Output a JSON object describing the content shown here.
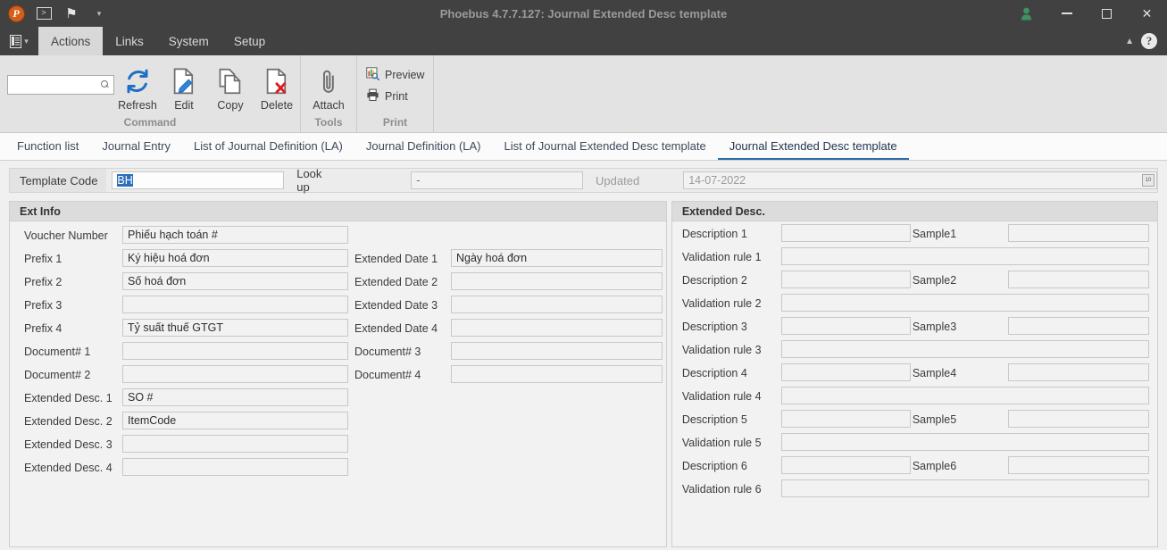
{
  "window": {
    "title": "Phoebus 4.7.7.127: Journal Extended Desc template",
    "logo_letter": "P",
    "quick_access": {
      "run_icon": ">",
      "bookmark_icon": "⚑",
      "dropdown_icon": "▾"
    },
    "controls": {
      "user_icon": "♟",
      "minimize": "—",
      "maximize": "□",
      "close": "✕"
    }
  },
  "menubar": {
    "app_icon": "document-menu",
    "items": [
      {
        "label": "Actions",
        "active": true
      },
      {
        "label": "Links",
        "active": false
      },
      {
        "label": "System",
        "active": false
      },
      {
        "label": "Setup",
        "active": false
      }
    ],
    "collapse_icon": "▲",
    "help_icon": "?"
  },
  "ribbon": {
    "search": {
      "value": "",
      "placeholder": ""
    },
    "groups": [
      {
        "title": "Command",
        "buttons": [
          {
            "label": "Refresh",
            "icon": "refresh-icon"
          },
          {
            "label": "Edit",
            "icon": "edit-icon"
          },
          {
            "label": "Copy",
            "icon": "copy-icon"
          },
          {
            "label": "Delete",
            "icon": "delete-icon"
          }
        ]
      },
      {
        "title": "Tools",
        "buttons": [
          {
            "label": "Attach",
            "icon": "attach-icon"
          }
        ]
      },
      {
        "title": "Print",
        "buttons": [
          {
            "label": "Preview",
            "icon": "preview-icon"
          },
          {
            "label": "Print",
            "icon": "print-icon"
          }
        ]
      }
    ]
  },
  "tabs": [
    {
      "label": "Function list",
      "selected": false
    },
    {
      "label": "Journal Entry",
      "selected": false
    },
    {
      "label": "List of Journal Definition (LA)",
      "selected": false
    },
    {
      "label": "Journal Definition (LA)",
      "selected": false
    },
    {
      "label": "List of Journal Extended Desc template",
      "selected": false
    },
    {
      "label": "Journal Extended Desc template",
      "selected": true
    }
  ],
  "header": {
    "template_code_label": "Template Code",
    "template_code_value": "BH",
    "lookup_label": "Look up",
    "lookup_value": "-",
    "updated_label": "Updated",
    "updated_value": "14-07-2022",
    "calendar_icon": "calendar-icon"
  },
  "ext_info": {
    "title": "Ext Info",
    "left_rows": [
      {
        "label": "Voucher Number",
        "value": "Phiếu hạch toán #"
      },
      {
        "label": "Prefix 1",
        "value": "Ký hiệu hoá đơn"
      },
      {
        "label": "Prefix 2",
        "value": "Số hoá đơn"
      },
      {
        "label": "Prefix 3",
        "value": ""
      },
      {
        "label": "Prefix 4",
        "value": "Tỷ suất thuế GTGT"
      },
      {
        "label": "Document# 1",
        "value": ""
      },
      {
        "label": "Document# 2",
        "value": ""
      },
      {
        "label": "Extended Desc. 1",
        "value": "SO #"
      },
      {
        "label": "Extended Desc. 2",
        "value": "ItemCode"
      },
      {
        "label": "Extended Desc. 3",
        "value": ""
      },
      {
        "label": "Extended Desc. 4",
        "value": ""
      }
    ],
    "right_rows": [
      {
        "label": "Extended Date 1",
        "value": "Ngày hoá đơn"
      },
      {
        "label": "Extended Date 2",
        "value": ""
      },
      {
        "label": "Extended Date 3",
        "value": ""
      },
      {
        "label": "Extended Date 4",
        "value": ""
      },
      {
        "label": "Document# 3",
        "value": ""
      },
      {
        "label": "Document# 4",
        "value": ""
      }
    ]
  },
  "extended_desc": {
    "title": "Extended Desc.",
    "rows": [
      {
        "type": "desc",
        "label": "Description 1",
        "value": "",
        "sample_label": "Sample1",
        "sample_value": ""
      },
      {
        "type": "rule",
        "label": "Validation rule 1",
        "value": ""
      },
      {
        "type": "desc",
        "label": "Description 2",
        "value": "",
        "sample_label": "Sample2",
        "sample_value": ""
      },
      {
        "type": "rule",
        "label": "Validation rule 2",
        "value": ""
      },
      {
        "type": "desc",
        "label": "Description 3",
        "value": "",
        "sample_label": "Sample3",
        "sample_value": ""
      },
      {
        "type": "rule",
        "label": "Validation rule 3",
        "value": ""
      },
      {
        "type": "desc",
        "label": "Description 4",
        "value": "",
        "sample_label": "Sample4",
        "sample_value": ""
      },
      {
        "type": "rule",
        "label": "Validation rule 4",
        "value": ""
      },
      {
        "type": "desc",
        "label": "Description 5",
        "value": "",
        "sample_label": "Sample5",
        "sample_value": ""
      },
      {
        "type": "rule",
        "label": "Validation rule 5",
        "value": ""
      },
      {
        "type": "desc",
        "label": "Description 6",
        "value": "",
        "sample_label": "Sample6",
        "sample_value": ""
      },
      {
        "type": "rule",
        "label": "Validation rule 6",
        "value": ""
      }
    ]
  },
  "colors": {
    "titlebar": "#414141",
    "accent": "#2e6ca8",
    "selection": "#2c6fbb",
    "ribbon_bg": "#e3e3e3",
    "panel_bg": "#f2f2f2"
  }
}
